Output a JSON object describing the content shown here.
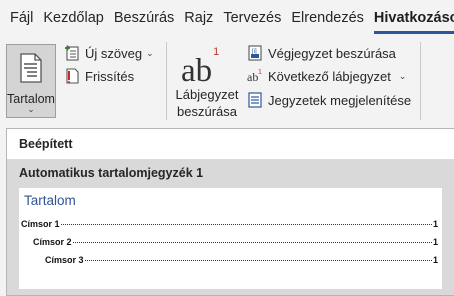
{
  "tabs": [
    "Fájl",
    "Kezdőlap",
    "Beszúrás",
    "Rajz",
    "Tervezés",
    "Elrendezés",
    "Hivatkozások"
  ],
  "ribbon": {
    "toc_button": "Tartalom",
    "add_text": "Új szöveg",
    "update_table": "Frissítés",
    "footnote_big": "ab",
    "footnote_superscript": "1",
    "insert_footnote_line1": "Lábjegyzet",
    "insert_footnote_line2": "beszúrása",
    "insert_endnote": "Végjegyzet beszúrása",
    "next_footnote": "Következő lábjegyzet",
    "show_notes": "Jegyzetek megjelenítése"
  },
  "dropdown": {
    "section_header": "Beépített",
    "gallery_item_title": "Automatikus tartalomjegyzék 1",
    "preview": {
      "heading": "Tartalom",
      "lines": [
        {
          "text": "Címsor 1",
          "page": "1"
        },
        {
          "text": "Címsor 2",
          "page": "1"
        },
        {
          "text": "Címsor 3",
          "page": "1"
        }
      ]
    }
  },
  "colors": {
    "active_tab_underline": "#2b579a",
    "preview_heading": "#2f5496",
    "toc_button_bg": "#d4d4d4",
    "gallery_bg": "#d9d9d9"
  },
  "icons": [
    "document-toc-icon",
    "add-text-icon",
    "update-table-icon",
    "insert-endnote-icon",
    "next-footnote-icon",
    "show-notes-icon"
  ]
}
